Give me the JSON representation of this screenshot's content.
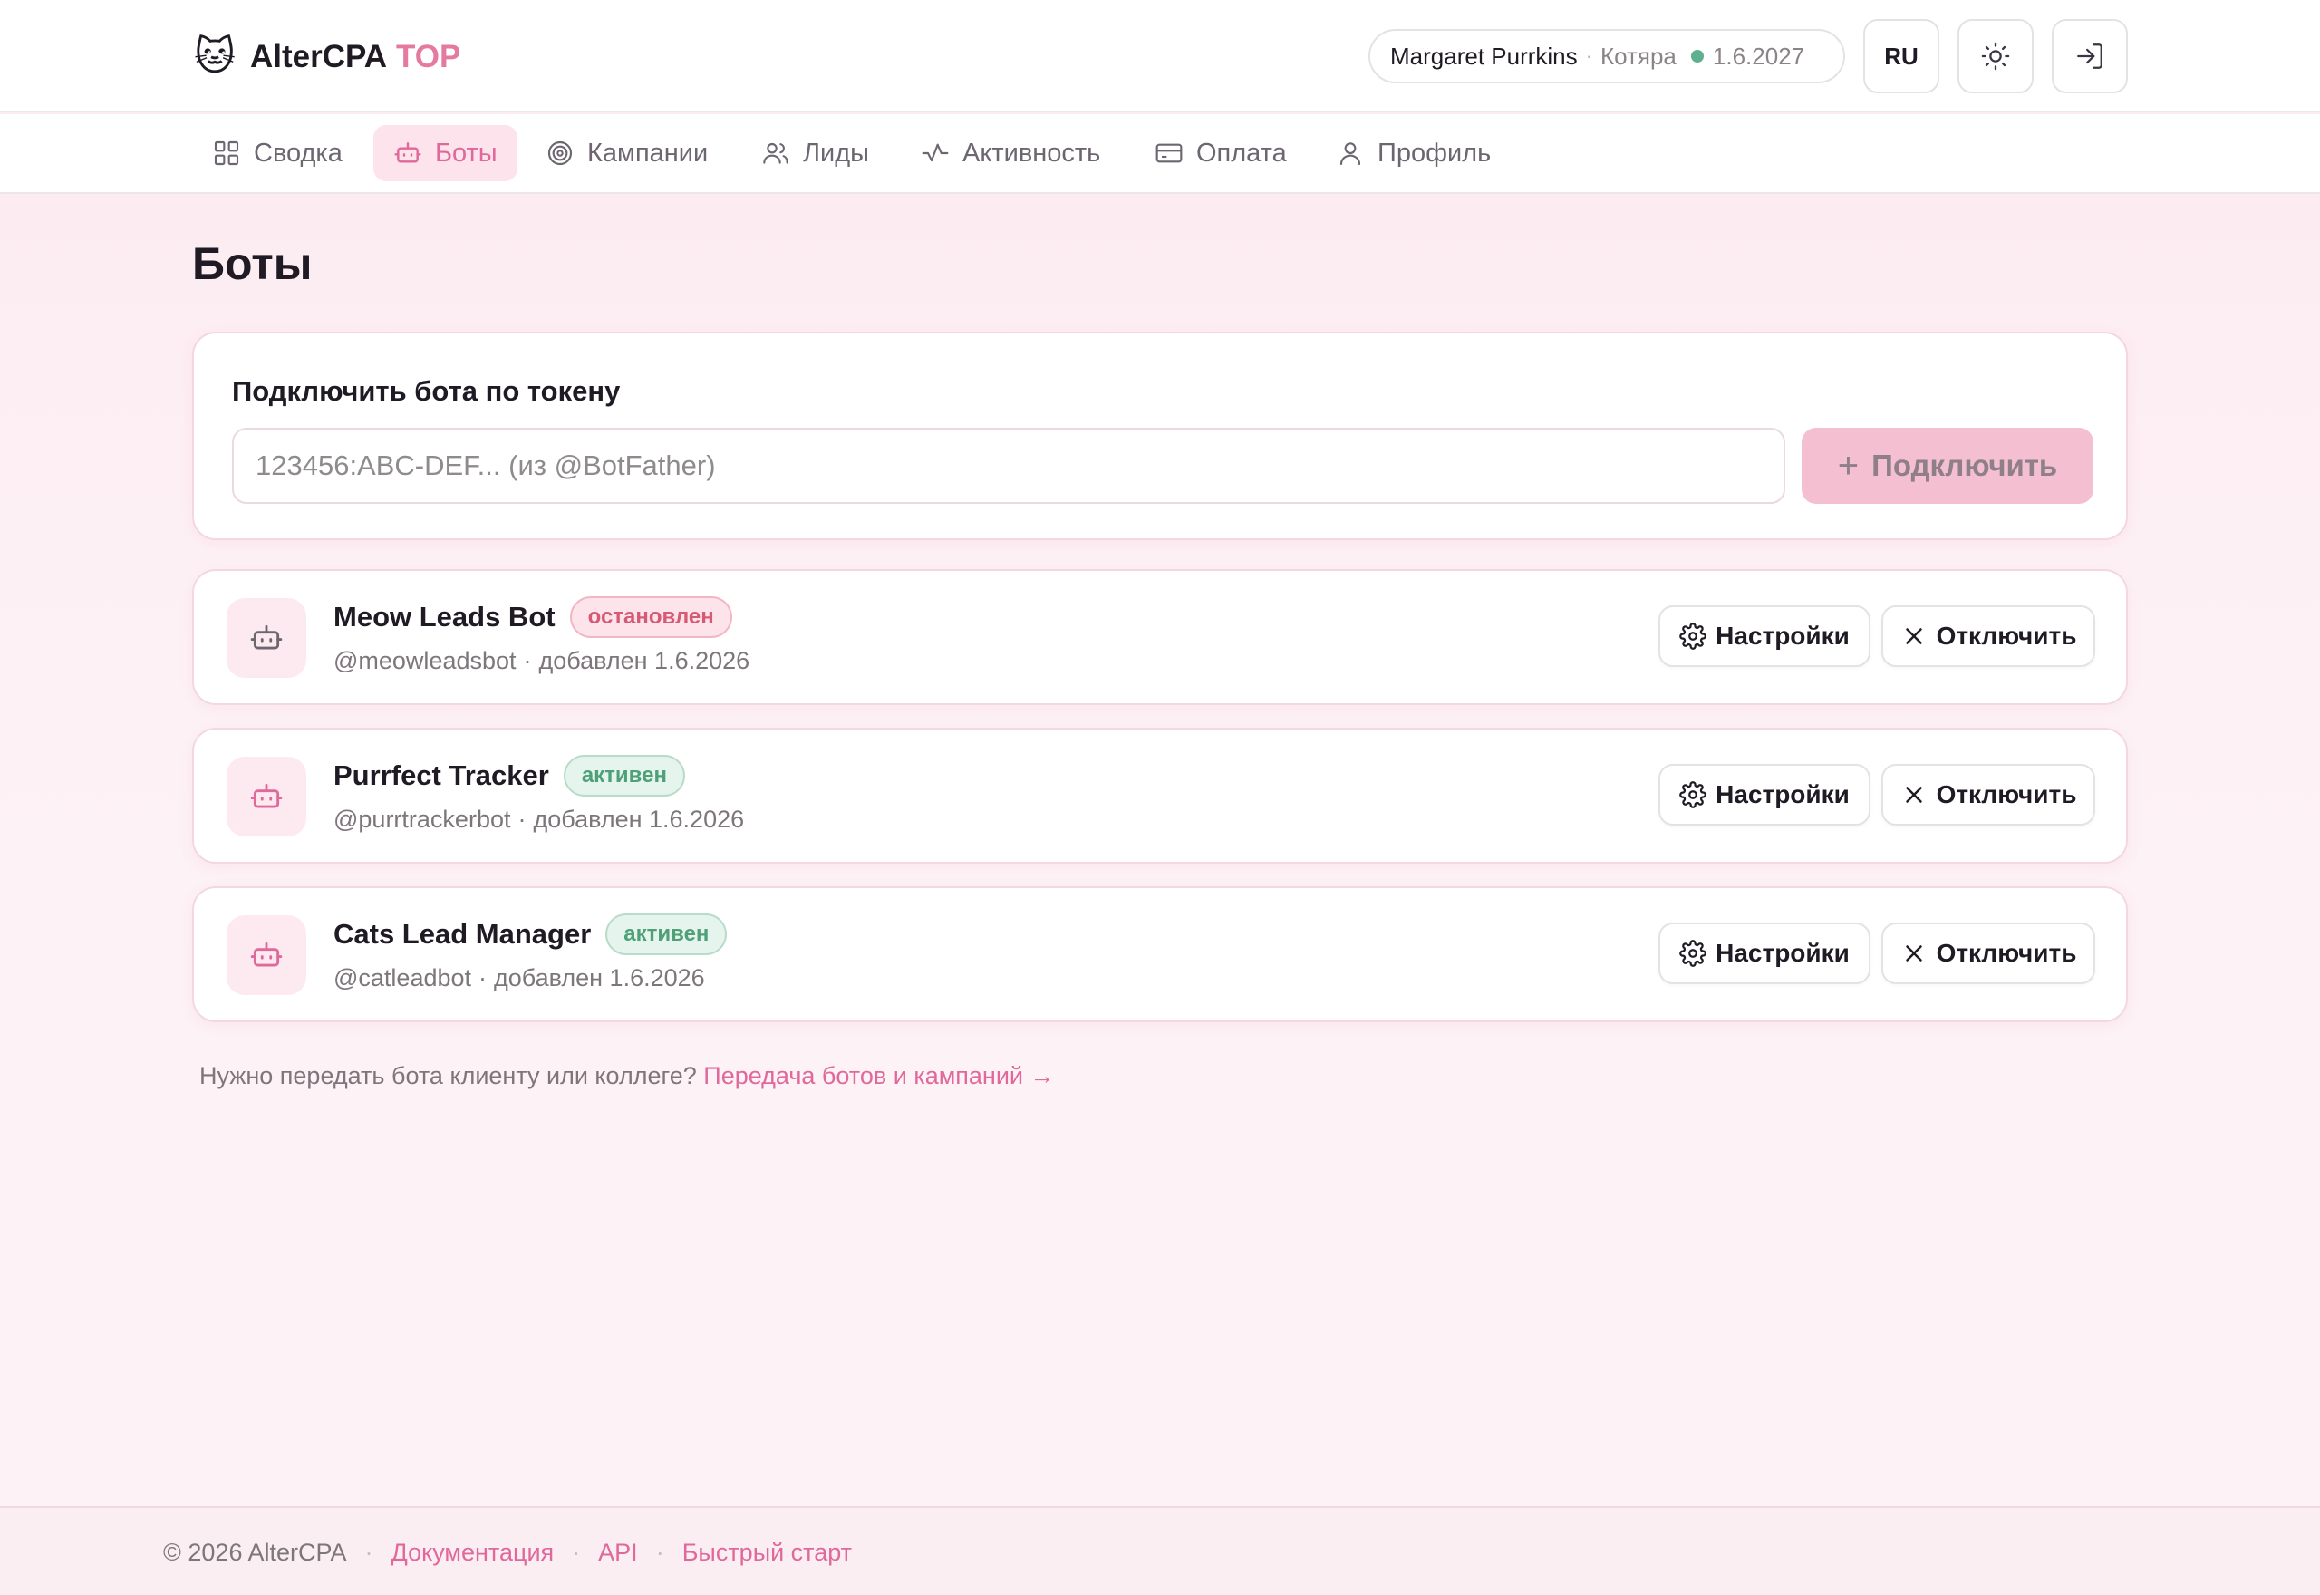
{
  "brand": {
    "logo": "🐱",
    "name": "AlterCPA",
    "tier": "TOP"
  },
  "header": {
    "user_name": "Margaret Purrkins",
    "separator": "·",
    "user_rank": "Котяра",
    "expiry_date": "1.6.2027",
    "language": "RU",
    "theme_icon": "sun-icon",
    "logout_icon": "logout-icon"
  },
  "nav": {
    "items": [
      {
        "label": "Сводка",
        "icon": "grid-icon"
      },
      {
        "label": "Боты",
        "icon": "bot-icon"
      },
      {
        "label": "Кампании",
        "icon": "target-icon"
      },
      {
        "label": "Лиды",
        "icon": "users-icon"
      },
      {
        "label": "Активность",
        "icon": "activity-icon"
      },
      {
        "label": "Оплата",
        "icon": "credit-card-icon"
      },
      {
        "label": "Профиль",
        "icon": "user-icon"
      }
    ],
    "active": "Боты"
  },
  "page": {
    "title": "Боты"
  },
  "connect": {
    "label": "Подключить бота по токену",
    "placeholder": "123456:ABC-DEF... (из @BotFather)",
    "value": "",
    "button_label": "Подключить"
  },
  "bots": [
    {
      "name": "Meow Leads Bot",
      "status": "остановлен",
      "handle": "@meowleadsbot",
      "added": "добавлен 1.6.2026",
      "settings_label": "Настройки",
      "disconnect_label": "Отключить"
    },
    {
      "name": "Purrfect Tracker",
      "status": "активен",
      "handle": "@purrtrackerbot",
      "added": "добавлен 1.6.2026",
      "settings_label": "Настройки",
      "disconnect_label": "Отключить"
    },
    {
      "name": "Cats Lead Manager",
      "status": "активен",
      "handle": "@catleadbot",
      "added": "добавлен 1.6.2026",
      "settings_label": "Настройки",
      "disconnect_label": "Отключить"
    }
  ],
  "transfer": {
    "text": "Нужно передать бота клиенту или коллеге?",
    "link": "Передача ботов и кампаний →"
  },
  "footer": {
    "copyright": "© 2026 AlterCPA",
    "links": [
      "Документация",
      "API",
      "Быстрый старт"
    ]
  },
  "colors": {
    "accent": "#e0689a",
    "brand_top": "#e47aa0",
    "active_status": "#4fa079",
    "stopped_status": "#d65a74",
    "online_dot": "#5fb08f"
  }
}
